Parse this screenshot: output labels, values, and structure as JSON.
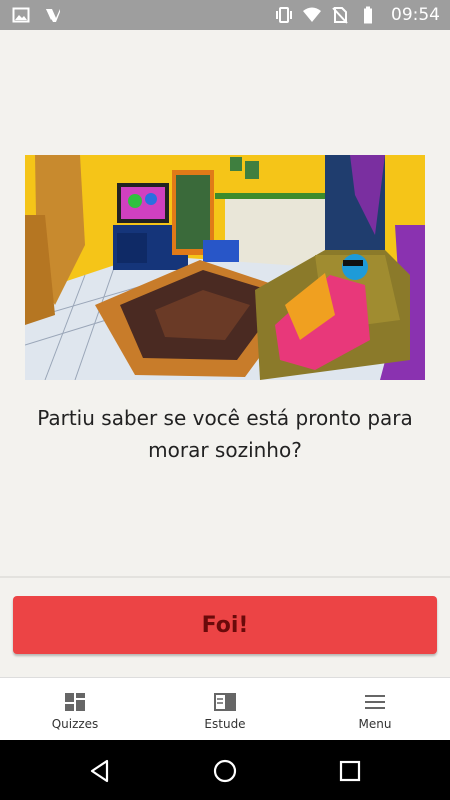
{
  "status_bar": {
    "time": "09:54",
    "left_icons": [
      "image-icon",
      "app-notification-icon"
    ],
    "right_icons": [
      "vibrate-icon",
      "wifi-icon",
      "no-sim-icon",
      "battery-icon"
    ]
  },
  "content": {
    "illustration": "living-room-illustration",
    "question": "Partiu saber se você está pronto para morar sozinho?"
  },
  "action": {
    "button_label": "Foi!",
    "button_color": "#ec4445"
  },
  "bottom_nav": {
    "items": [
      {
        "label": "Quizzes",
        "icon": "grid-icon"
      },
      {
        "label": "Estude",
        "icon": "book-icon"
      },
      {
        "label": "Menu",
        "icon": "hamburger-icon"
      }
    ]
  },
  "system_nav": {
    "buttons": [
      "back-icon",
      "home-icon",
      "recents-icon"
    ]
  }
}
